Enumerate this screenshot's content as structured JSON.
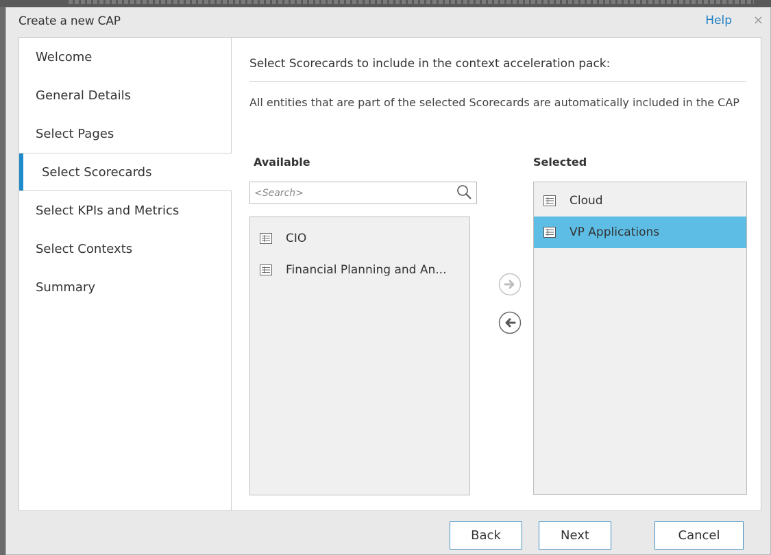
{
  "dialog": {
    "title": "Create a new CAP",
    "help_label": "Help",
    "close_glyph": "×"
  },
  "nav": {
    "items": [
      {
        "label": "Welcome"
      },
      {
        "label": "General Details"
      },
      {
        "label": "Select Pages"
      },
      {
        "label": "Select Scorecards",
        "active": true
      },
      {
        "label": "Select KPIs and Metrics"
      },
      {
        "label": "Select Contexts"
      },
      {
        "label": "Summary"
      }
    ]
  },
  "main": {
    "heading": "Select Scorecards to include in the context acceleration pack:",
    "description": "All entities that are part of the selected Scorecards are automatically included in the CAP",
    "available": {
      "header": "Available",
      "search_placeholder": "<Search>",
      "items": [
        {
          "label": "CIO",
          "icon": "scorecard-icon"
        },
        {
          "label": "Financial Planning and An...",
          "icon": "scorecard-icon"
        }
      ]
    },
    "selected": {
      "header": "Selected",
      "items": [
        {
          "label": "Cloud",
          "icon": "scorecard-icon"
        },
        {
          "label": "VP Applications",
          "icon": "scorecard-icon",
          "selected": true
        }
      ]
    }
  },
  "footer": {
    "back_label": "Back",
    "next_label": "Next",
    "cancel_label": "Cancel"
  },
  "colors": {
    "accent": "#1e8ac9",
    "selection": "#5dbde4",
    "link": "#1e7fc4"
  }
}
